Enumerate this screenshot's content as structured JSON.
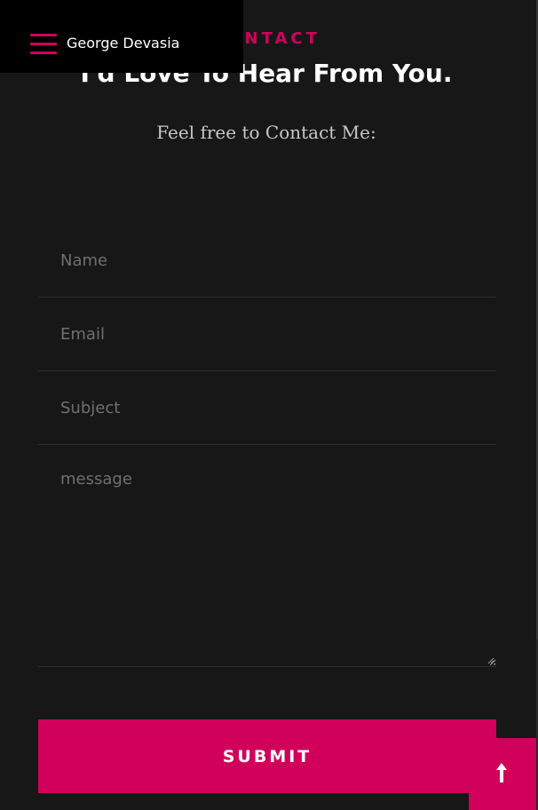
{
  "nav": {
    "site_name": "George Devasia",
    "menu_icon": "hamburger-menu-icon"
  },
  "section": {
    "label": "CONTACT",
    "title": "I'd Love To Hear From You.",
    "subtitle": "Feel free to Contact Me:"
  },
  "form": {
    "name_placeholder": "Name",
    "email_placeholder": "Email",
    "subject_placeholder": "Subject",
    "message_placeholder": "message",
    "submit_label": "SUBMIT"
  },
  "back_to_top": {
    "icon": "arrow-up-icon"
  },
  "colors": {
    "accent": "#d1005b",
    "background": "#171717",
    "nav_background": "#000000",
    "placeholder": "#6f6f6f",
    "divider": "#2f2f2f"
  }
}
